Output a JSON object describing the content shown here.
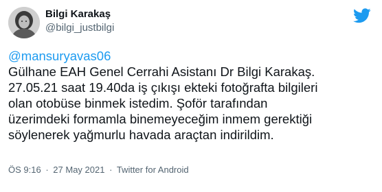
{
  "author": {
    "display_name": "Bilgi Karakaş",
    "handle": "@bilgi_justbilgi"
  },
  "icons": {
    "brand": "twitter-bird-icon",
    "brand_color": "#1d9bf0",
    "avatar": "avatar"
  },
  "tweet": {
    "mention": "@mansuryavas06",
    "lines": [
      "Gülhane EAH Genel Cerrahi Asistanı Dr Bilgi Karakaş.",
      "27.05.21 saat 19.40da iş çıkışı ekteki fotoğrafta bilgileri",
      "olan otobüse binmek istedim. Şoför tarafından",
      "üzerimdeki formamla binemeyeceğim inmem gerektiği",
      "söylenerek yağmurlu havada araçtan indirildim."
    ]
  },
  "meta": {
    "time": "ÖS 9:16",
    "date": "27 May 2021",
    "source": "Twitter for Android",
    "separator": "·"
  },
  "colors": {
    "text": "#0f1419",
    "secondary": "#536471",
    "link": "#1d9bf0"
  }
}
